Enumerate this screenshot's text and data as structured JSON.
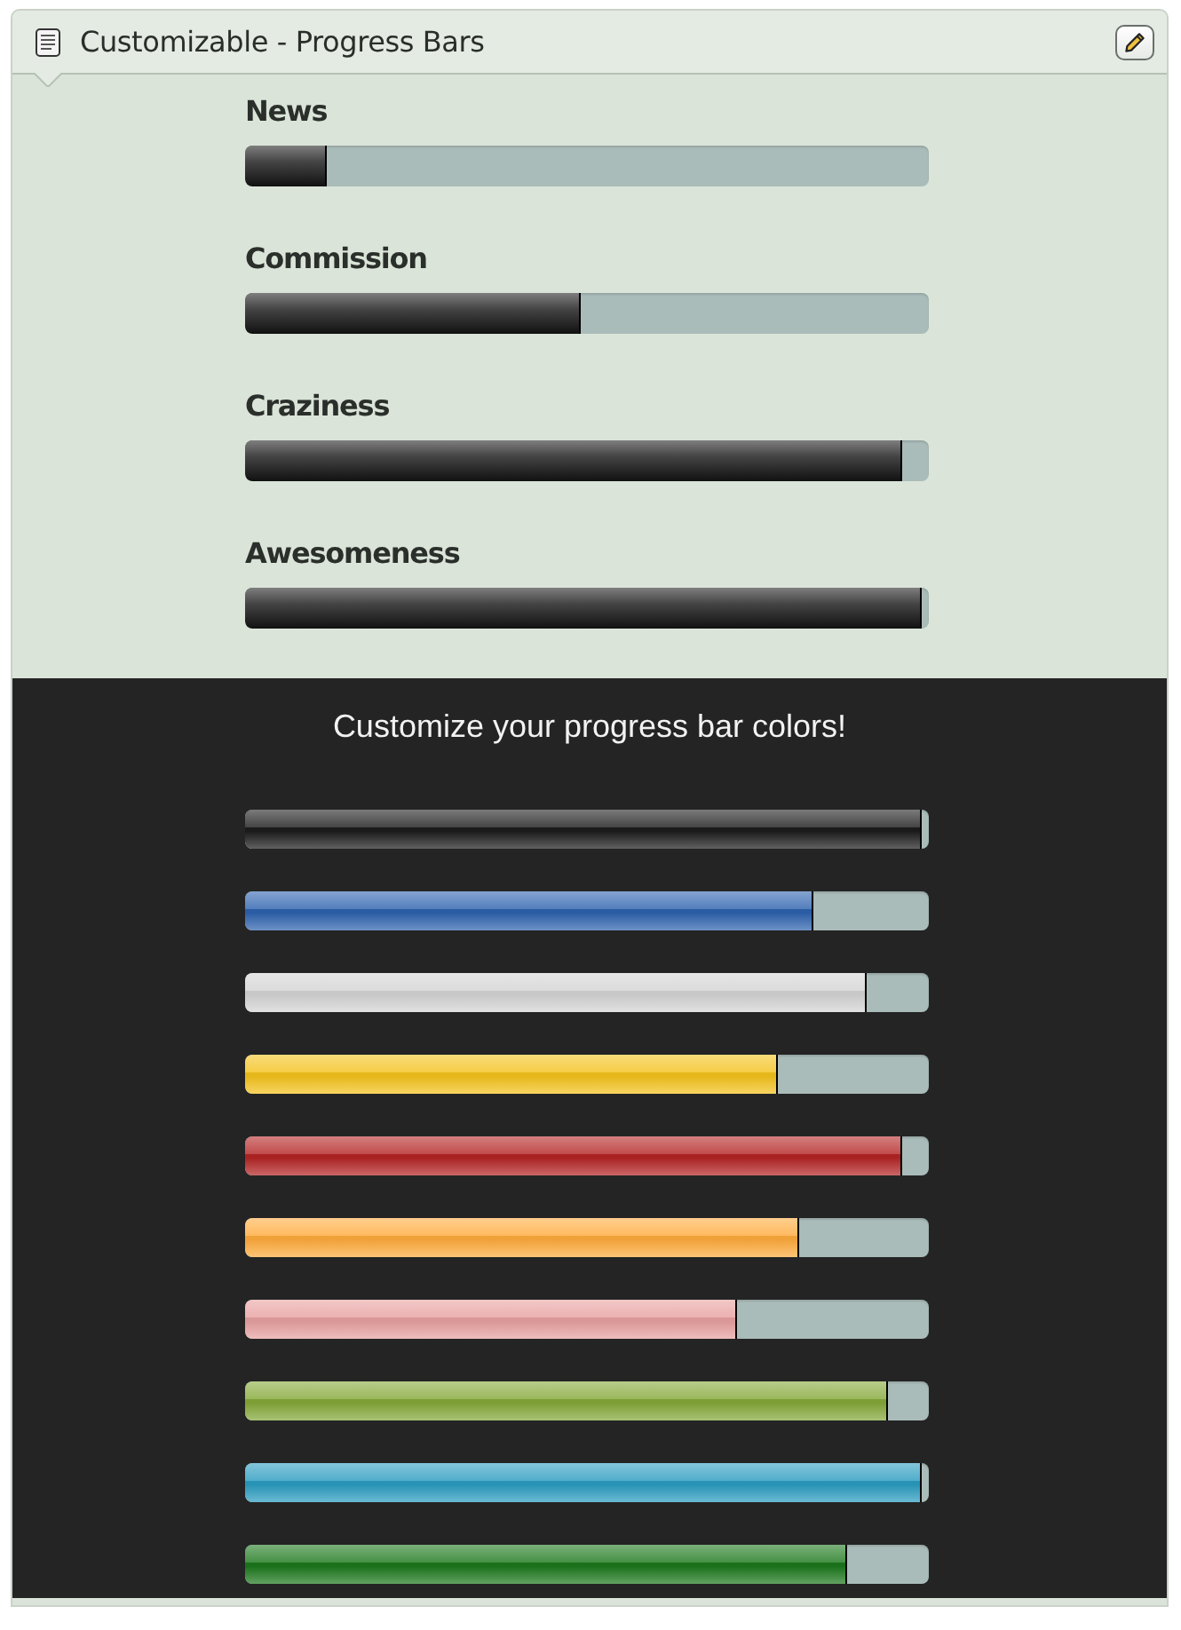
{
  "panel": {
    "title": "Customizable - Progress Bars"
  },
  "progress_bars": [
    {
      "label": "News",
      "level": 0.12
    },
    {
      "label": "Commission",
      "level": 0.49
    },
    {
      "label": "Craziness",
      "level": 0.96
    },
    {
      "label": "Awesomeness",
      "level": 0.99
    }
  ],
  "color_demo": {
    "heading": "Customize your progress bar colors!",
    "bars": [
      {
        "color": "#1c1c1c",
        "level": 0.99
      },
      {
        "color": "#2d62ae",
        "level": 0.83
      },
      {
        "color": "#d4d4d4",
        "level": 0.91
      },
      {
        "color": "#f4c21c",
        "level": 0.78
      },
      {
        "color": "#b42424",
        "level": 0.96
      },
      {
        "color": "#ffab3c",
        "level": 0.81
      },
      {
        "color": "#e8a0a0",
        "level": 0.72
      },
      {
        "color": "#84a838",
        "level": 0.94
      },
      {
        "color": "#2a9cc0",
        "level": 0.99
      },
      {
        "color": "#1c781c",
        "level": 0.88
      }
    ]
  }
}
